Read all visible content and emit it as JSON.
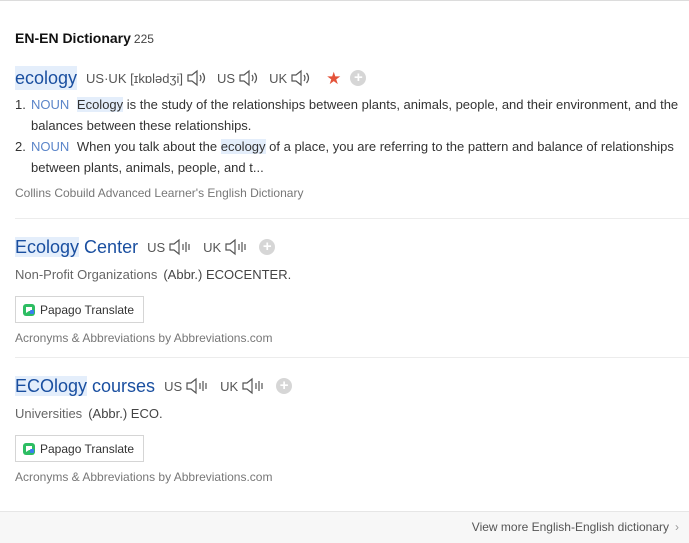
{
  "header": {
    "title": "EN-EN Dictionary",
    "count": "225"
  },
  "entry1": {
    "headword": "ecology",
    "pron1_label": "US·UK [ɪkɒlədʒi]",
    "pron2_label": "US",
    "pron3_label": "UK",
    "defs": [
      {
        "num": "1.",
        "pos": "NOUN",
        "pre": "",
        "hl": "Ecology",
        "post": " is the study of the relationships between plants, animals, people, and their environment, and the balances between these relationships."
      },
      {
        "num": "2.",
        "pos": "NOUN",
        "pre": "When you talk about the ",
        "hl": "ecology",
        "post": " of a place, you are referring to the pattern and balance of relationships between plants, animals, people, and t..."
      }
    ],
    "source": "Collins Cobuild Advanced Learner's English Dictionary"
  },
  "entry2": {
    "hl": "Ecology",
    "rest": " Center",
    "us": "US",
    "uk": "UK",
    "category": "Non-Profit Organizations",
    "abbr": "(Abbr.) ECOCENTER.",
    "button": "Papago Translate",
    "source": "Acronyms & Abbreviations by Abbreviations.com"
  },
  "entry3": {
    "hl": "ECOlogy",
    "rest": " courses",
    "us": "US",
    "uk": "UK",
    "category": "Universities",
    "abbr": "(Abbr.) ECO.",
    "button": "Papago Translate",
    "source": "Acronyms & Abbreviations by Abbreviations.com"
  },
  "footer": {
    "more": "View more English-English dictionary",
    "chevron": "›"
  },
  "colors": {
    "link": "#1a4fa0",
    "pos": "#5b85c9",
    "highlight": "#e4eefb",
    "star": "#e4533a"
  }
}
